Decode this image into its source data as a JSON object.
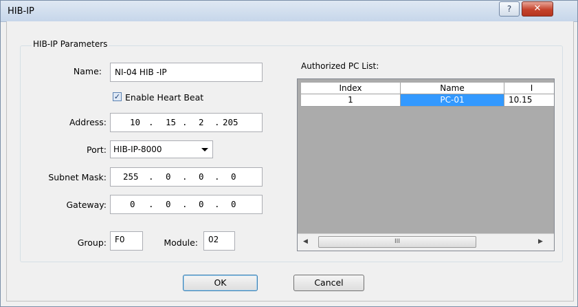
{
  "window": {
    "title": "HIB-IP",
    "help_glyph": "?",
    "close_glyph": "✕"
  },
  "params": {
    "group_title": "HIB-IP Parameters",
    "name_label": "Name:",
    "name_value": "NI-04 HIB -IP",
    "heartbeat_label": "Enable Heart Beat",
    "heartbeat_checked": true,
    "address_label": "Address:",
    "address": [
      "10",
      "15",
      "2",
      "205"
    ],
    "port_label": "Port:",
    "port_value": "HIB-IP-8000",
    "subnet_label": "Subnet Mask:",
    "subnet": [
      "255",
      "0",
      "0",
      "0"
    ],
    "gateway_label": "Gateway:",
    "gateway": [
      "0",
      "0",
      "0",
      "0"
    ],
    "group_label": "Group:",
    "group_value": "F0",
    "module_label": "Module:",
    "module_value": "02"
  },
  "pc_list": {
    "title": "Authorized PC List:",
    "columns": [
      "Index",
      "Name",
      "I"
    ],
    "rows": [
      {
        "index": "1",
        "name": "PC-01",
        "ip": "10.15"
      }
    ],
    "scroll_thumb_glyph": "III"
  },
  "buttons": {
    "ok": "OK",
    "cancel": "Cancel"
  }
}
